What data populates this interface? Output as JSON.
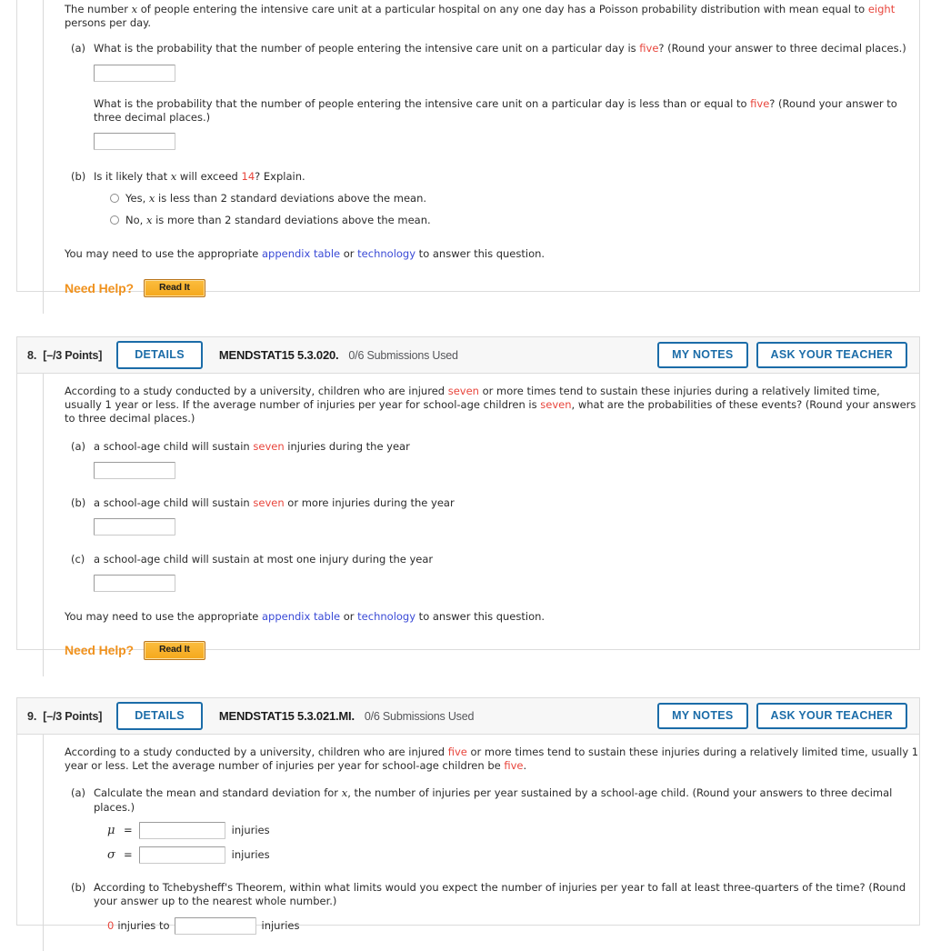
{
  "question7": {
    "stem_parts": [
      "The number ",
      "x",
      " of people entering the intensive care unit at a particular hospital on any one day has a Poisson probability distribution with mean equal to ",
      "eight",
      " persons per day."
    ],
    "stem_text_1": "The number ",
    "stem_var": "x",
    "stem_text_2": " of people entering the intensive care unit at a particular hospital on any one day has a Poisson probability distribution with mean equal to ",
    "stem_red": "eight",
    "stem_text_3": " persons per day.",
    "part_a_label": "(a)",
    "part_a_q1_pre": "What is the probability that the number of people entering the intensive care unit on a particular day is ",
    "part_a_q1_red": "five",
    "part_a_q1_post": "? (Round your answer to three decimal places.)",
    "part_a_q2_pre": "What is the probability that the number of people entering the intensive care unit on a particular day is less than or equal to ",
    "part_a_q2_red": "five",
    "part_a_q2_post": "? (Round your answer to three decimal places.)",
    "part_b_label": "(b)",
    "part_b_pre": "Is it likely that ",
    "part_b_var": "x",
    "part_b_mid": " will exceed ",
    "part_b_red": "14",
    "part_b_post": "? Explain.",
    "choice_1_pre": "Yes, ",
    "choice_1_var": "x",
    "choice_1_post": " is less than 2 standard deviations above the mean.",
    "choice_2_pre": "No, ",
    "choice_2_var": "x",
    "choice_2_post": " is more than 2 standard deviations above the mean.",
    "note_pre": "You may need to use the appropriate ",
    "note_link1": "appendix table",
    "note_mid": " or ",
    "note_link2": "technology",
    "note_post": " to answer this question.",
    "need_help_label": "Need Help?",
    "read_it_label": "Read It"
  },
  "question8": {
    "number": "8.",
    "points": "[–/3 Points]",
    "details_label": "DETAILS",
    "code": "MENDSTAT15 5.3.020.",
    "submissions": "0/6 Submissions Used",
    "my_notes_label": "MY NOTES",
    "ask_teacher_label": "ASK YOUR TEACHER",
    "stem_1": "According to a study conducted by a university, children who are injured ",
    "stem_red_1": "seven",
    "stem_2": " or more times tend to sustain these injuries during a relatively limited time, usually 1 year or less. If the average number of injuries per year for school-age children is ",
    "stem_red_2": "seven",
    "stem_3": ", what are the probabilities of these events? (Round your answers to three decimal places.)",
    "part_a_label": "(a)",
    "part_a_pre": "a school-age child will sustain ",
    "part_a_red": "seven",
    "part_a_post": " injuries during the year",
    "part_b_label": "(b)",
    "part_b_pre": "a school-age child will sustain ",
    "part_b_red": "seven",
    "part_b_post": " or more injuries during the year",
    "part_c_label": "(c)",
    "part_c_text": "a school-age child will sustain at most one injury during the year",
    "note_pre": "You may need to use the appropriate ",
    "note_link1": "appendix table",
    "note_mid": " or ",
    "note_link2": "technology",
    "note_post": " to answer this question.",
    "need_help_label": "Need Help?",
    "read_it_label": "Read It"
  },
  "question9": {
    "number": "9.",
    "points": "[–/3 Points]",
    "details_label": "DETAILS",
    "code": "MENDSTAT15 5.3.021.MI.",
    "submissions": "0/6 Submissions Used",
    "my_notes_label": "MY NOTES",
    "ask_teacher_label": "ASK YOUR TEACHER",
    "stem_1": "According to a study conducted by a university, children who are injured ",
    "stem_red_1": "five",
    "stem_2": " or more times tend to sustain these injuries during a relatively limited time, usually 1 year or less. Let the average number of injuries per year for school-age children be ",
    "stem_red_2": "five",
    "stem_3": ".",
    "part_a_label": "(a)",
    "part_a_pre": "Calculate the mean and standard deviation for ",
    "part_a_var": "x",
    "part_a_post": ", the number of injuries per year sustained by a school-age child. (Round your answers to three decimal places.)",
    "mu_symbol": "μ",
    "sigma_symbol": "σ",
    "equals": "=",
    "unit_label": "injuries",
    "part_b_label": "(b)",
    "part_b_text": "According to Tchebysheff's Theorem, within what limits would you expect the number of injuries per year to fall at least three-quarters of the time? (Round your answer up to the nearest whole number.)",
    "range_from_value": "0",
    "range_from_unit": "injuries to",
    "range_to_unit": "injuries"
  },
  "colors": {
    "accent_blue": "#1b6ca8",
    "red_value": "#e8453c",
    "link_blue": "#3a4ad6",
    "orange": "#f0921e"
  }
}
